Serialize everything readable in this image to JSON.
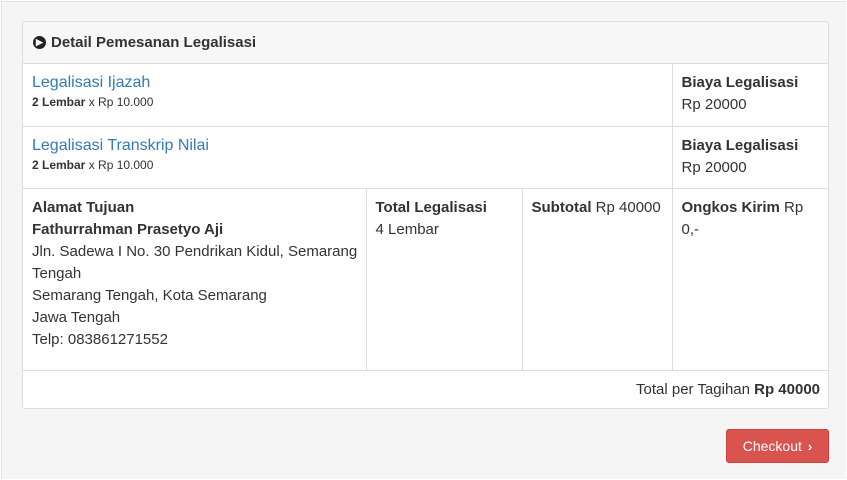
{
  "panel": {
    "title": "Detail Pemesanan Legalisasi",
    "icon": "circle-arrow-right-icon"
  },
  "items": [
    {
      "name": "Legalisasi Ijazah",
      "qty_bold": "2 Lembar",
      "qty_rest": " x Rp 10.000",
      "fee_label": "Biaya Legalisasi",
      "fee_value": "Rp 20000"
    },
    {
      "name": "Legalisasi Transkrip Nilai",
      "qty_bold": "2 Lembar",
      "qty_rest": " x Rp 10.000",
      "fee_label": "Biaya Legalisasi",
      "fee_value": "Rp 20000"
    }
  ],
  "address": {
    "label": "Alamat Tujuan",
    "name": "Fathurrahman Prasetyo Aji",
    "line1": "Jln. Sadewa I No. 30 Pendrikan Kidul, Semarang Tengah",
    "line2": "Semarang Tengah, Kota Semarang",
    "line3": "Jawa Tengah",
    "phone": "Telp: 083861271552"
  },
  "totals": {
    "total_label": "Total Legalisasi",
    "total_value": "4 Lembar",
    "subtotal_label": "Subtotal",
    "subtotal_value": " Rp 40000",
    "shipping_label": "Ongkos Kirim",
    "shipping_value": " Rp 0,-",
    "invoice_label": "Total per Tagihan ",
    "invoice_value": "Rp 40000"
  },
  "checkout": {
    "label": "Checkout",
    "icon": "chevron-right-icon",
    "color": "#d9534f"
  }
}
